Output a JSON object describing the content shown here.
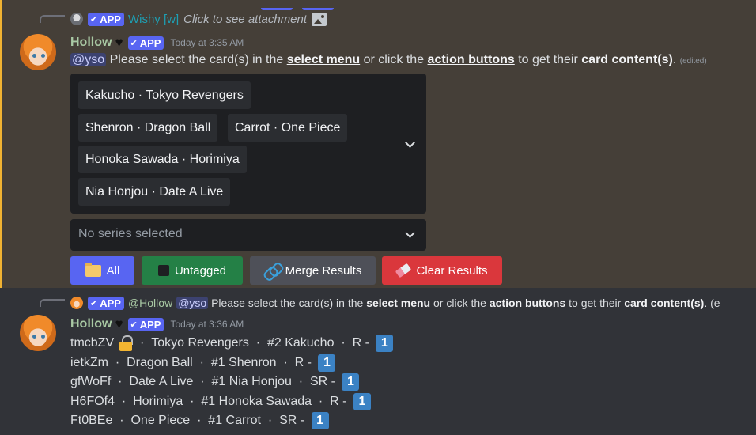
{
  "message1": {
    "reply": {
      "app_badge": "APP",
      "username": "Wishy [w]",
      "text": "Click to see attachment"
    },
    "author": "Hollow",
    "app_badge": "APP",
    "timestamp": "Today at 3:35 AM",
    "mention": "@yso",
    "text": {
      "part1": " Please select the card(s) in the ",
      "link1": "select menu",
      "part2": " or click the ",
      "link2": "action buttons",
      "part3": " to get their ",
      "bold": "card content(s)",
      "part4": ".",
      "edited": "(edited)"
    },
    "select_menu": {
      "chips": [
        "Kakucho · Tokyo Revengers",
        "Shenron · Dragon Ball",
        "Carrot · One Piece",
        "Honoka Sawada · Horimiya",
        "Nia Honjou · Date A Live"
      ]
    },
    "series_select": {
      "placeholder": "No series selected"
    },
    "buttons": [
      {
        "label": "All",
        "icon": "folder-icon",
        "color": "#5865f2"
      },
      {
        "label": "Untagged",
        "icon": "square-icon",
        "color": "#248046"
      },
      {
        "label": "Merge Results",
        "icon": "link-icon",
        "color": "#4e5058"
      },
      {
        "label": "Clear Results",
        "icon": "eraser-icon",
        "color": "#da373c"
      }
    ]
  },
  "message2": {
    "reply": {
      "app_badge": "APP",
      "username": "@Hollow",
      "mention": "@yso",
      "part1": " Please select the card(s) in the ",
      "link1": "select menu",
      "part2": " or click the ",
      "link2": "action buttons",
      "part3": " to get their ",
      "bold": "card content(s)",
      "part4": ". (e"
    },
    "author": "Hollow",
    "app_badge": "APP",
    "timestamp": "Today at 3:36 AM",
    "results": [
      {
        "code": "tmcbZV",
        "locked": true,
        "series": "Tokyo Revengers",
        "character": "#2 Kakucho",
        "rarity": "R",
        "count": "1"
      },
      {
        "code": "ietkZm",
        "locked": false,
        "series": "Dragon Ball",
        "character": "#1 Shenron",
        "rarity": "R",
        "count": "1"
      },
      {
        "code": "gfWoFf",
        "locked": false,
        "series": "Date A Live",
        "character": "#1 Nia Honjou",
        "rarity": "SR",
        "count": "1"
      },
      {
        "code": "H6FOf4",
        "locked": false,
        "series": "Horimiya",
        "character": "#1 Honoka Sawada",
        "rarity": "R",
        "count": "1"
      },
      {
        "code": "Ft0BEe",
        "locked": false,
        "series": "One Piece",
        "character": "#1 Carrot",
        "rarity": "SR",
        "count": "1"
      }
    ]
  },
  "colors": {
    "highlight_bg": "#453f38",
    "highlight_bar": "#f0b232",
    "app_badge": "#5865f2",
    "username": "#a9c9a4",
    "count_badge": "#3b82c4"
  }
}
